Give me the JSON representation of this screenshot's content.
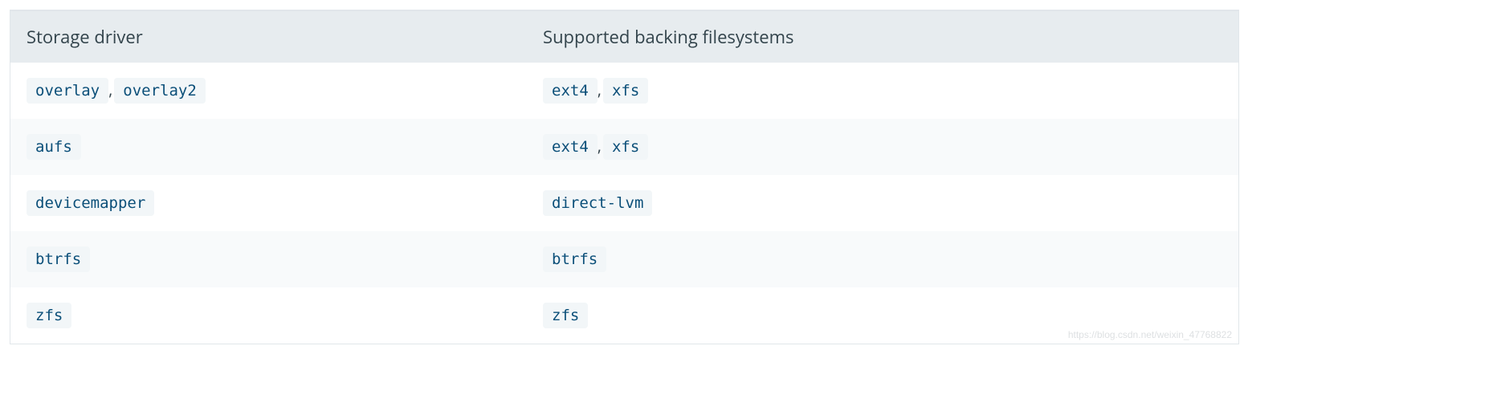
{
  "table": {
    "headers": [
      "Storage driver",
      "Supported backing filesystems"
    ],
    "rows": [
      {
        "driver": [
          "overlay",
          "overlay2"
        ],
        "fs": [
          "ext4",
          "xfs"
        ]
      },
      {
        "driver": [
          "aufs"
        ],
        "fs": [
          "ext4",
          "xfs"
        ]
      },
      {
        "driver": [
          "devicemapper"
        ],
        "fs": [
          "direct-lvm"
        ]
      },
      {
        "driver": [
          "btrfs"
        ],
        "fs": [
          "btrfs"
        ]
      },
      {
        "driver": [
          "zfs"
        ],
        "fs": [
          "zfs"
        ]
      }
    ],
    "separator": ","
  },
  "watermark": "https://blog.csdn.net/weixin_47768822"
}
